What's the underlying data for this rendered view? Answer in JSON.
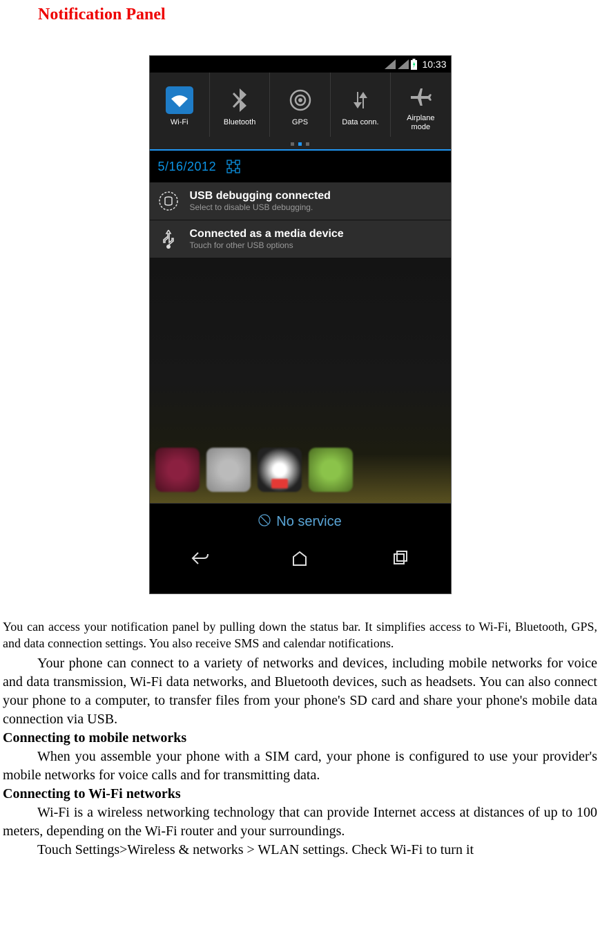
{
  "doc": {
    "heading": "Notification Panel",
    "caption": "You can access your notification panel by pulling down the status bar. It simplifies access to Wi-Fi, Bluetooth, GPS, and data connection settings. You also receive SMS and calendar notifications.",
    "p_intro": "Your phone can connect to a variety of networks and devices, including mobile networks for voice and data transmission, Wi-Fi data networks, and Bluetooth devices, such as headsets. You can also connect your phone to a computer, to transfer files from your phone's SD card and share your phone's mobile data connection via USB.",
    "h_mobile": "Connecting to mobile networks",
    "p_mobile": "When you assemble your phone with a SIM card, your phone is configured to use your provider's mobile networks for voice calls and for transmitting data.",
    "h_wifi": "Connecting to Wi-Fi networks",
    "p_wifi1": "Wi-Fi is a wireless networking technology that can provide Internet access at distances of up to 100 meters, depending on the Wi-Fi router and your surroundings.",
    "p_wifi2": "Touch Settings>Wireless & networks > WLAN settings. Check Wi-Fi to turn it"
  },
  "phone": {
    "clock": "10:33",
    "quick_settings": {
      "wifi": "Wi-Fi",
      "bluetooth": "Bluetooth",
      "gps": "GPS",
      "data": "Data conn.",
      "airplane": "Airplane\nmode"
    },
    "date": "5/16/2012",
    "notifications": [
      {
        "title": "USB debugging connected",
        "sub": "Select to disable USB debugging."
      },
      {
        "title": "Connected as a media device",
        "sub": "Touch for other USB options"
      }
    ],
    "carrier": "No service"
  }
}
